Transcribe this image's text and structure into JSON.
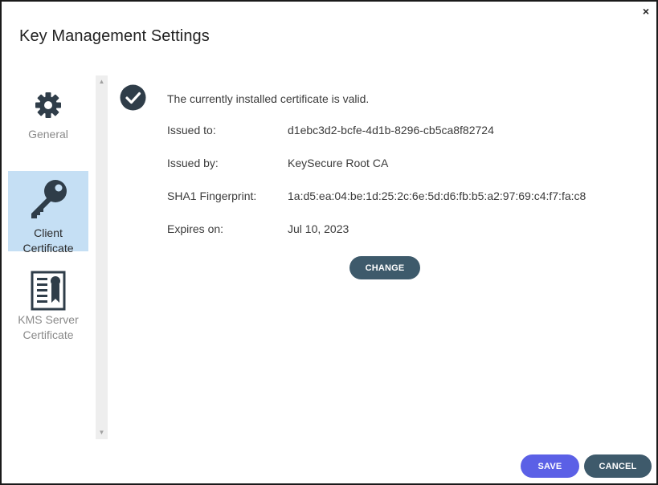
{
  "dialog": {
    "title": "Key Management Settings",
    "close_glyph": "×"
  },
  "nav": {
    "items": [
      {
        "label": "General",
        "icon": "gear-icon",
        "active": false
      },
      {
        "label": "Client\nCertificate",
        "icon": "key-icon",
        "active": true
      },
      {
        "label": "KMS Server\nCertificate",
        "icon": "certificate-icon",
        "active": false
      }
    ]
  },
  "certificate": {
    "status": "The currently installed certificate is valid.",
    "fields": [
      {
        "label": "Issued to:",
        "value": "d1ebc3d2-bcfe-4d1b-8296-cb5ca8f82724"
      },
      {
        "label": "Issued by:",
        "value": "KeySecure Root CA"
      },
      {
        "label": "SHA1 Fingerprint:",
        "value": "1a:d5:ea:04:be:1d:25:2c:6e:5d:d6:fb:b5:a2:97:69:c4:f7:fa:c8"
      },
      {
        "label": "Expires on:",
        "value": "Jul 10, 2023"
      }
    ],
    "change_label": "CHANGE"
  },
  "footer": {
    "save_label": "SAVE",
    "cancel_label": "CANCEL"
  },
  "colors": {
    "active_nav_bg": "#c5dff4",
    "primary_button": "#5b60e6",
    "secondary_button": "#3e5a6b",
    "icon_dark": "#2f3d49"
  }
}
